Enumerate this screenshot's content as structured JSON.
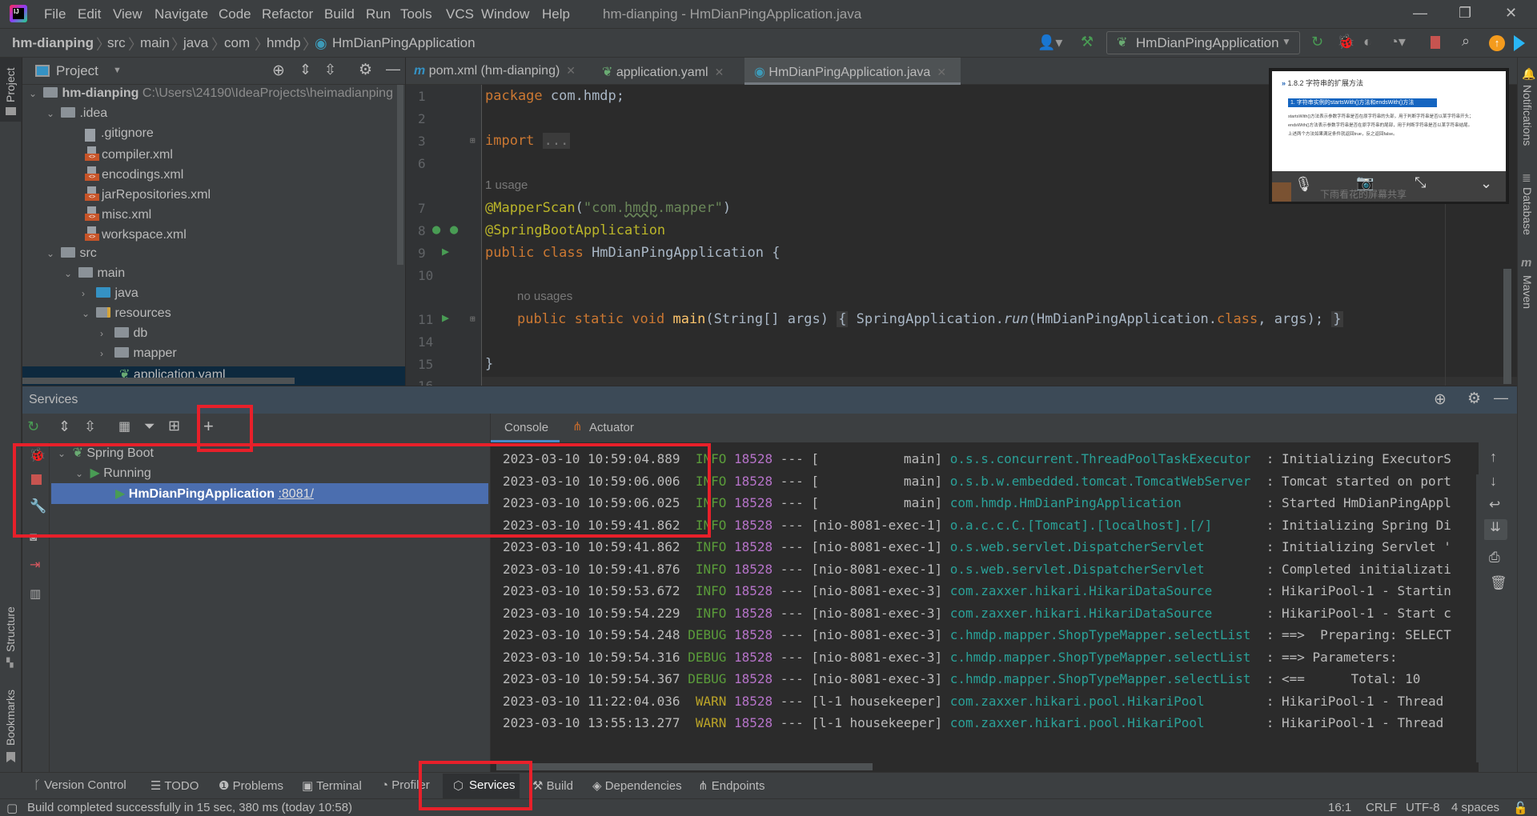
{
  "app": {
    "window_title": "hm-dianping - HmDianPingApplication.java",
    "menu": [
      "File",
      "Edit",
      "View",
      "Navigate",
      "Code",
      "Refactor",
      "Build",
      "Run",
      "Tools",
      "VCS",
      "Window",
      "Help"
    ]
  },
  "breadcrumb": [
    "hm-dianping",
    "src",
    "main",
    "java",
    "com",
    "hmdp",
    "HmDianPingApplication"
  ],
  "run_config": {
    "selected": "HmDianPingApplication"
  },
  "left_strip": {
    "project_label": "Project",
    "structure_label": "Structure",
    "bookmarks_label": "Bookmarks"
  },
  "right_strip": {
    "notifications_label": "Notifications",
    "database_label": "Database",
    "maven_label": "Maven"
  },
  "project_panel": {
    "title": "Project",
    "tree": [
      {
        "label": "hm-dianping",
        "detail": "C:\\Users\\24190\\IdeaProjects\\heimadianping",
        "type": "module",
        "expanded": true
      },
      {
        "label": ".idea",
        "type": "folder",
        "expanded": true
      },
      {
        "label": ".gitignore",
        "type": "ignore-file"
      },
      {
        "label": "compiler.xml",
        "type": "xml"
      },
      {
        "label": "encodings.xml",
        "type": "xml"
      },
      {
        "label": "jarRepositories.xml",
        "type": "xml"
      },
      {
        "label": "misc.xml",
        "type": "xml"
      },
      {
        "label": "workspace.xml",
        "type": "xml"
      },
      {
        "label": "src",
        "type": "folder",
        "expanded": true
      },
      {
        "label": "main",
        "type": "folder",
        "expanded": true
      },
      {
        "label": "java",
        "type": "source-folder",
        "expanded": false
      },
      {
        "label": "resources",
        "type": "resources-folder",
        "expanded": true
      },
      {
        "label": "db",
        "type": "folder",
        "expanded": false
      },
      {
        "label": "mapper",
        "type": "folder",
        "expanded": false
      },
      {
        "label": "application.yaml",
        "type": "yaml",
        "selected": true
      }
    ]
  },
  "editor": {
    "tabs": [
      {
        "label": "pom.xml (hm-dianping)",
        "icon": "maven-icon",
        "active": false
      },
      {
        "label": "application.yaml",
        "icon": "spring-yaml-icon",
        "active": false
      },
      {
        "label": "HmDianPingApplication.java",
        "icon": "spring-class-icon",
        "active": true
      }
    ],
    "lines": [
      {
        "n": "1",
        "code": "package com.hmdp;"
      },
      {
        "n": "2",
        "code": ""
      },
      {
        "n": "3",
        "code": "import ..."
      },
      {
        "n": "6",
        "code": ""
      },
      {
        "n": "",
        "hint": "1 usage"
      },
      {
        "n": "7",
        "code": "@MapperScan(\"com.hmdp.mapper\")"
      },
      {
        "n": "8",
        "code": "@SpringBootApplication"
      },
      {
        "n": "9",
        "code": "public class HmDianPingApplication {"
      },
      {
        "n": "10",
        "code": ""
      },
      {
        "n": "",
        "hint": "no usages"
      },
      {
        "n": "11",
        "code": "public static void main(String[] args) { SpringApplication.run(HmDianPingApplication.class, args); }"
      },
      {
        "n": "14",
        "code": ""
      },
      {
        "n": "15",
        "code": "}"
      },
      {
        "n": "16",
        "code": ""
      }
    ]
  },
  "meeting_overlay": {
    "doc_heading": "1.8.2  字符串的扩展方法",
    "doc_highlight": "1. 字符串实例的startsWith()方法和endsWith()方法",
    "doc_lines": [
      "startsWith()方法表示参数字符串是否在原字符串的头部，用于判断字符串是否以某字符串开头；",
      "endsWith()方法表示参数字符串是否在原字符串的尾部，用于判断字符串是否以某字符串结尾。",
      "上述两个方法如果满足条件就返回true，反之返回false。"
    ],
    "share_label": "下雨看花的屏幕共享"
  },
  "services": {
    "title": "Services",
    "tree": [
      {
        "label": "Spring Boot",
        "level": 0
      },
      {
        "label": "Running",
        "level": 1
      },
      {
        "label": "HmDianPingApplication",
        "port_link": ":8081/",
        "level": 2,
        "selected": true
      }
    ],
    "console_tabs": [
      "Console",
      "Actuator"
    ],
    "log": [
      {
        "ts": "2023-03-10 10:59:04.889",
        "level": " INFO",
        "pid": "18528",
        "thread": "[           main]",
        "logger": "o.s.s.concurrent.ThreadPoolTaskExecutor  ",
        "msg": ": Initializing ExecutorS"
      },
      {
        "ts": "2023-03-10 10:59:06.006",
        "level": " INFO",
        "pid": "18528",
        "thread": "[           main]",
        "logger": "o.s.b.w.embedded.tomcat.TomcatWebServer  ",
        "msg": ": Tomcat started on port"
      },
      {
        "ts": "2023-03-10 10:59:06.025",
        "level": " INFO",
        "pid": "18528",
        "thread": "[           main]",
        "logger": "com.hmdp.HmDianPingApplication           ",
        "msg": ": Started HmDianPingAppl"
      },
      {
        "ts": "2023-03-10 10:59:41.862",
        "level": " INFO",
        "pid": "18528",
        "thread": "[nio-8081-exec-1]",
        "logger": "o.a.c.c.C.[Tomcat].[localhost].[/]       ",
        "msg": ": Initializing Spring Di"
      },
      {
        "ts": "2023-03-10 10:59:41.862",
        "level": " INFO",
        "pid": "18528",
        "thread": "[nio-8081-exec-1]",
        "logger": "o.s.web.servlet.DispatcherServlet        ",
        "msg": ": Initializing Servlet '"
      },
      {
        "ts": "2023-03-10 10:59:41.876",
        "level": " INFO",
        "pid": "18528",
        "thread": "[nio-8081-exec-1]",
        "logger": "o.s.web.servlet.DispatcherServlet        ",
        "msg": ": Completed initializati"
      },
      {
        "ts": "2023-03-10 10:59:53.672",
        "level": " INFO",
        "pid": "18528",
        "thread": "[nio-8081-exec-3]",
        "logger": "com.zaxxer.hikari.HikariDataSource       ",
        "msg": ": HikariPool-1 - Startin"
      },
      {
        "ts": "2023-03-10 10:59:54.229",
        "level": " INFO",
        "pid": "18528",
        "thread": "[nio-8081-exec-3]",
        "logger": "com.zaxxer.hikari.HikariDataSource       ",
        "msg": ": HikariPool-1 - Start c"
      },
      {
        "ts": "2023-03-10 10:59:54.248",
        "level": "DEBUG",
        "pid": "18528",
        "thread": "[nio-8081-exec-3]",
        "logger": "c.hmdp.mapper.ShopTypeMapper.selectList  ",
        "msg": ": ==>  Preparing: SELECT"
      },
      {
        "ts": "2023-03-10 10:59:54.316",
        "level": "DEBUG",
        "pid": "18528",
        "thread": "[nio-8081-exec-3]",
        "logger": "c.hmdp.mapper.ShopTypeMapper.selectList  ",
        "msg": ": ==> Parameters: "
      },
      {
        "ts": "2023-03-10 10:59:54.367",
        "level": "DEBUG",
        "pid": "18528",
        "thread": "[nio-8081-exec-3]",
        "logger": "c.hmdp.mapper.ShopTypeMapper.selectList  ",
        "msg": ": <==      Total: 10"
      },
      {
        "ts": "2023-03-10 11:22:04.036",
        "level": " WARN",
        "pid": "18528",
        "thread": "[l-1 housekeeper]",
        "logger": "com.zaxxer.hikari.pool.HikariPool        ",
        "msg": ": HikariPool-1 - Thread"
      },
      {
        "ts": "2023-03-10 13:55:13.277",
        "level": " WARN",
        "pid": "18528",
        "thread": "[l-1 housekeeper]",
        "logger": "com.zaxxer.hikari.pool.HikariPool        ",
        "msg": ": HikariPool-1 - Thread"
      }
    ]
  },
  "bottom_tabs": [
    "Version Control",
    "TODO",
    "Problems",
    "Terminal",
    "Profiler",
    "Services",
    "Build",
    "Dependencies",
    "Endpoints"
  ],
  "active_bottom_tab": "Services",
  "status": {
    "message": "Build completed successfully in 15 sec, 380 ms (today 10:58)",
    "position": "16:1",
    "line_separator": "CRLF",
    "encoding": "UTF-8",
    "indent": "4 spaces"
  },
  "colors": {
    "accent": "#4b6eaf",
    "highlight_red": "#e8202a",
    "run_green": "#499c54",
    "stop_red": "#c75450"
  }
}
